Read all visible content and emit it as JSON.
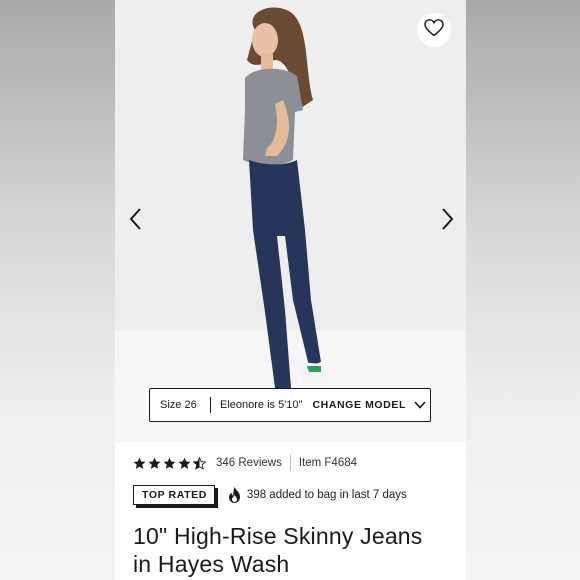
{
  "colors": {
    "ink": "#1a1a1a",
    "hero_background": "#eeeeef",
    "denim": "#26365a",
    "sneaker_accent": "#2e9e5b"
  },
  "hero": {
    "favorite_icon": "heart-outline-icon",
    "prev_icon": "chevron-left-icon",
    "next_icon": "chevron-right-icon"
  },
  "model_selector": {
    "size_label": "Size 26",
    "model_height": "Eleonore is 5'10\"",
    "change_label": "CHANGE MODEL",
    "dropdown_icon": "chevron-down-icon"
  },
  "product": {
    "rating": 4.5,
    "rating_max": 5,
    "reviews_label": "346 Reviews",
    "item_label": "Item F4684",
    "badge_label": "TOP RATED",
    "popularity_icon": "flame-icon",
    "popularity_text": "398 added to bag in last 7 days",
    "title_line1": "10\" High-Rise Skinny Jeans",
    "title_line2": "in Hayes Wash"
  }
}
